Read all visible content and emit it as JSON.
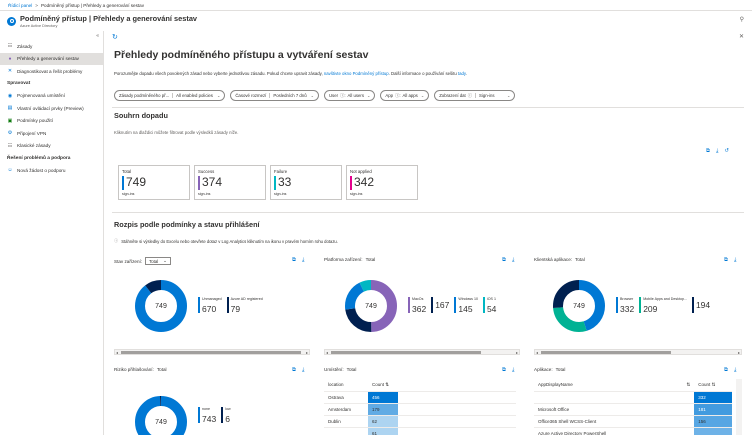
{
  "breadcrumb": {
    "home": "Řídicí panel",
    "sep": ">",
    "current": "Podmíněný přístup | Přehledy a generování sestav"
  },
  "header": {
    "title": "Podmíněný přístup | Přehledy a generování sestav",
    "subtitle": "Azure Active Directory"
  },
  "sidebar": {
    "items": [
      {
        "label": "Zásady",
        "icon": "policy-icon"
      },
      {
        "label": "Přehledy a generování sestav",
        "icon": "insights-icon"
      },
      {
        "label": "Diagnostikovat a řešit problémy",
        "icon": "wrench-icon"
      }
    ],
    "group_manage": "Spravovat",
    "manage_items": [
      {
        "label": "Pojmenovaná umístění",
        "icon": "location-icon"
      },
      {
        "label": "Vlastní ovládací prvky (Preview)",
        "icon": "controls-icon"
      },
      {
        "label": "Podmínky použití",
        "icon": "terms-icon"
      },
      {
        "label": "Připojení VPN",
        "icon": "vpn-icon"
      },
      {
        "label": "Klasické zásady",
        "icon": "classic-policy-icon"
      }
    ],
    "group_support": "Řešení problémů a podpora",
    "support_items": [
      {
        "label": "Nová žádost o podporu",
        "icon": "person-icon"
      }
    ]
  },
  "main": {
    "title": "Přehledy podmíněného přístupu a vytváření sestav",
    "intro_text": "Porozumějte dopadu všech povolených zásad nebo vyberte jednotlivou zásadu. Pokud chcete upravit zásady,",
    "intro_link1": "navštivte okno Podmíněný přístup",
    "intro_text2": ". Další informace o používání sešitu",
    "intro_link2": "tady",
    "filters": [
      {
        "label": "Zásady podmíněného př...",
        "value": "All enabled policies"
      },
      {
        "label": "Časové rozmezí",
        "value": "Posledních 7 dnů"
      },
      {
        "label": "User",
        "value": "All users"
      },
      {
        "label": "App",
        "value": "All apps"
      },
      {
        "label": "Zobrazení dat",
        "value": "Sign-ins"
      }
    ],
    "summary": {
      "title": "Souhrn dopadu",
      "desc": "Kliknutím na dlaždici můžete filtrovat podle výsledků zásady níže.",
      "tiles": [
        {
          "label": "Total",
          "value": "749",
          "sub": "sign-ins",
          "color": "#0078d4"
        },
        {
          "label": "Success",
          "value": "374",
          "sub": "sign-ins",
          "color": "#8764b8"
        },
        {
          "label": "Failure",
          "value": "33",
          "sub": "sign-ins",
          "color": "#00b7c3"
        },
        {
          "label": "Not applied",
          "value": "342",
          "sub": "sign-ins",
          "color": "#e3008c"
        }
      ]
    },
    "breakdown": {
      "title": "Rozpis podle podmínky a stavu přihlášení",
      "info": "Stáhněte si výsledky do Excelu nebo otevřete dotaz v Log Analytics kliknutím na ikonu v pravém horním rohu dotazu."
    },
    "panels": {
      "device_state": {
        "title": "Stav zařízení:",
        "value": "Total",
        "center": "749",
        "legend": [
          {
            "name": "Unmanaged",
            "value": "670",
            "color": "#0078d4"
          },
          {
            "name": "Azure AD registered",
            "value": "79",
            "color": "#002050"
          }
        ]
      },
      "platform": {
        "title": "Platforma zařízení:",
        "value": "Total",
        "center": "749",
        "legend": [
          {
            "name": "MacOs",
            "value": "362",
            "color": "#8764b8"
          },
          {
            "name": "",
            "value": "167",
            "color": "#002050"
          },
          {
            "name": "Windows 10",
            "value": "145",
            "color": "#0078d4"
          },
          {
            "name": "iOS 1",
            "value": "54",
            "color": "#00b7c3"
          }
        ]
      },
      "client_app": {
        "title": "Klientská aplikace:",
        "value": "Total",
        "center": "749",
        "legend": [
          {
            "name": "Browser",
            "value": "332",
            "color": "#0078d4"
          },
          {
            "name": "Mobile Apps and Desktop...",
            "value": "209",
            "color": "#00b294"
          },
          {
            "name": "",
            "value": "194",
            "color": "#002050"
          }
        ]
      },
      "sign_in_risk": {
        "title": "Riziko přihlašování:",
        "value": "Total",
        "center": "749",
        "legend": [
          {
            "name": "none",
            "value": "743",
            "color": "#0078d4"
          },
          {
            "name": "low",
            "value": "6",
            "color": "#002050"
          }
        ]
      },
      "location": {
        "title": "Umístění:",
        "value": "Total",
        "col1": "location",
        "col2": "Count",
        "rows": [
          {
            "name": "Ostrava",
            "count": "456",
            "level": 1.0
          },
          {
            "name": "Amsterdam",
            "count": "179",
            "level": 0.55
          },
          {
            "name": "Dublin",
            "count": "62",
            "level": 0.2
          },
          {
            "name": "",
            "count": "61",
            "level": 0.2
          }
        ]
      },
      "application": {
        "title": "Aplikace:",
        "value": "Total",
        "col1": "AppDisplayName",
        "col2": "Count",
        "rows": [
          {
            "name": "",
            "count": "332",
            "level": 1.0
          },
          {
            "name": "Microsoft Office",
            "count": "181",
            "level": 0.7
          },
          {
            "name": "Office365 Shell WCSS-Client",
            "count": "156",
            "level": 0.6
          },
          {
            "name": "Azure Active Directory PowerShell",
            "count": "",
            "level": 0.5
          }
        ]
      }
    },
    "donuts": {
      "device_state": [
        {
          "value": 670,
          "color": "#0078d4"
        },
        {
          "value": 79,
          "color": "#002050"
        }
      ],
      "platform": [
        {
          "value": 362,
          "color": "#8764b8"
        },
        {
          "value": 167,
          "color": "#002050"
        },
        {
          "value": 145,
          "color": "#0078d4"
        },
        {
          "value": 54,
          "color": "#00b7c3"
        }
      ],
      "client_app": [
        {
          "value": 332,
          "color": "#0078d4"
        },
        {
          "value": 209,
          "color": "#00b294"
        },
        {
          "value": 194,
          "color": "#002050"
        }
      ],
      "sign_in_risk": [
        {
          "value": 743,
          "color": "#0078d4"
        },
        {
          "value": 6,
          "color": "#002050"
        }
      ]
    }
  }
}
